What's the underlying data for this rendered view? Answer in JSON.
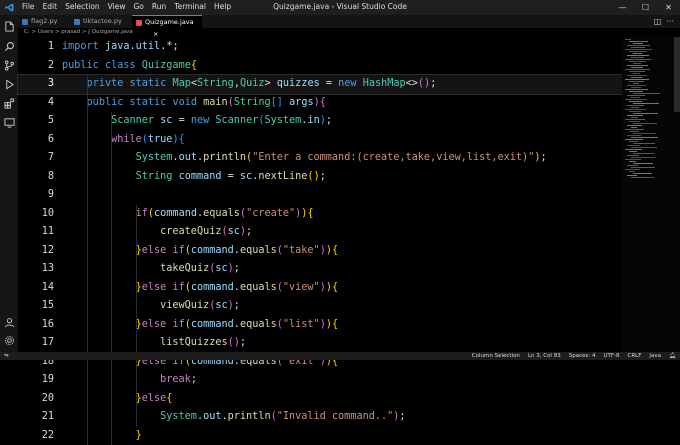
{
  "app": {
    "menu": [
      "File",
      "Edit",
      "Selection",
      "View",
      "Go",
      "Run",
      "Terminal",
      "Help"
    ],
    "window_title": "Quizgame.java - Visual Studio Code",
    "controls": {
      "minimize": "—",
      "maximize": "☐",
      "close": "✕"
    }
  },
  "activity_icons": [
    "explorer-icon",
    "search-icon",
    "source-control-icon",
    "run-debug-icon",
    "extensions-icon",
    "remote-explorer-icon",
    "account-icon",
    "settings-gear-icon"
  ],
  "tabs": [
    {
      "label": "flag2.py",
      "color": "#3b76b6"
    },
    {
      "label": "tiktactoe.py",
      "color": "#3b76b6"
    },
    {
      "label": "Quizgame.java",
      "color": "#e05252",
      "close": "×"
    }
  ],
  "breadcrumb": "C: > Users > prasad > J Quizgame.java",
  "code_lines": [
    {
      "n": "1",
      "text": "import java.util.*;"
    },
    {
      "n": "2",
      "text": "public class Quizgame{"
    },
    {
      "n": "3",
      "text": "    privte static Map<String,Quiz> quizzes = new HashMap<>();"
    },
    {
      "n": "4",
      "text": "    public static void main(String[] args){"
    },
    {
      "n": "5",
      "text": "        Scanner sc = new Scanner(System.in);"
    },
    {
      "n": "6",
      "text": "        while(true){"
    },
    {
      "n": "7",
      "text": "            System.out.println(\"Enter a command:(create,take,view,list,exit)\");"
    },
    {
      "n": "8",
      "text": "            String command = sc.nextLine();"
    },
    {
      "n": "9",
      "text": ""
    },
    {
      "n": "10",
      "text": "            if(command.equals(\"create\")){"
    },
    {
      "n": "11",
      "text": "                createQuiz(sc);"
    },
    {
      "n": "12",
      "text": "            }else if(command.equals(\"take\")){"
    },
    {
      "n": "13",
      "text": "                takeQuiz(sc);"
    },
    {
      "n": "14",
      "text": "            }else if(command.equals(\"view\")){"
    },
    {
      "n": "15",
      "text": "                viewQuiz(sc);"
    },
    {
      "n": "16",
      "text": "            }else if(command.equals(\"list\")){"
    },
    {
      "n": "17",
      "text": "                listQuizzes();"
    },
    {
      "n": "18",
      "text": "            }else if(command.equals(\"exit\")){"
    },
    {
      "n": "19",
      "text": "                break;"
    },
    {
      "n": "20",
      "text": "            }else{"
    },
    {
      "n": "21",
      "text": "                System.out.println(\"Invalid command..\");"
    },
    {
      "n": "22",
      "text": "            }"
    }
  ],
  "current_line": "3",
  "status": {
    "left_icon": "remote-icon",
    "items": [
      "Column Selection",
      "Ln 3, Col 83",
      "Spaces: 4",
      "UTF-8",
      "CRLF",
      "Java"
    ]
  },
  "colors": {
    "keyword": "#4a9fe6",
    "control": "#c586c0",
    "type": "#4ec9b0",
    "function": "#dcdcaa",
    "variable": "#9cdcfe",
    "string": "#ce9178",
    "punct": "#dcdcdc",
    "bracket1": "#ffd700",
    "bracket2": "#da70d6",
    "bracket3": "#179fff"
  }
}
